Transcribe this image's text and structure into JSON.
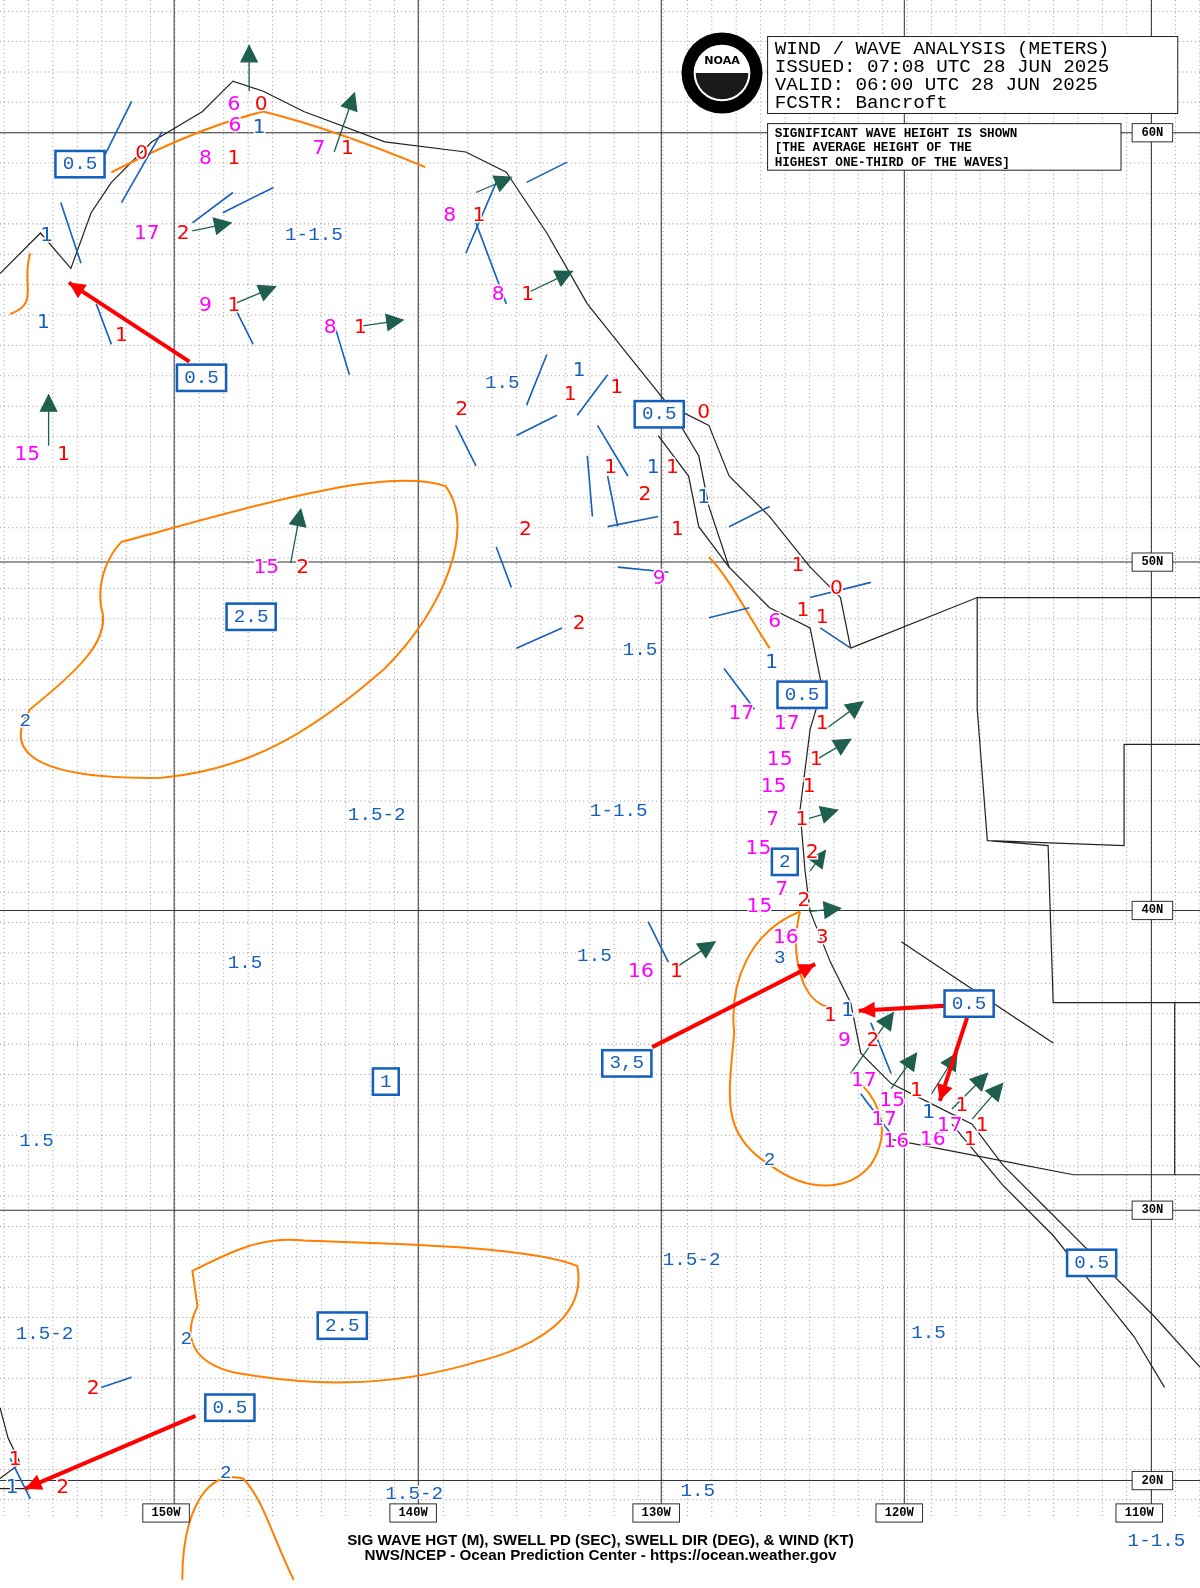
{
  "header": {
    "title": "WIND / WAVE ANALYSIS (METERS)",
    "issued": "ISSUED: 07:08 UTC 28 JUN 2025",
    "valid": "VALID:  06:00 UTC 28 JUN 2025",
    "forecaster": "FCSTR:  Bancroft"
  },
  "logo": {
    "text": "NOAA"
  },
  "note": [
    "SIGNIFICANT WAVE HEIGHT IS SHOWN",
    "[THE AVERAGE HEIGHT OF THE",
    "HIGHEST ONE-THIRD OF THE WAVES]"
  ],
  "latitudes": [
    "60N",
    "50N",
    "40N",
    "30N",
    "20N"
  ],
  "longitudes": [
    "150W",
    "140W",
    "130W",
    "120W",
    "110W"
  ],
  "boxed_labels": [
    "0.5",
    "0.5",
    "0.5",
    "2.5",
    "0.5",
    "2",
    "1",
    "3,5",
    "0.5",
    "0.5",
    "2.5",
    "0.5"
  ],
  "area_labels": [
    "1-1.5",
    "1.5",
    "1.5",
    "1.5-2",
    "1-1.5",
    "1.5",
    "1.5",
    "1.5",
    "1.5-2",
    "1.5-2",
    "1.5",
    "1.5-2",
    "1.5",
    "1-1.5"
  ],
  "contour_labels": [
    "3",
    "2",
    "2",
    "2",
    "2"
  ],
  "observations": [
    {
      "text": "6",
      "kind": "period"
    },
    {
      "text": "6",
      "kind": "period"
    },
    {
      "text": "8",
      "kind": "period"
    },
    {
      "text": "7",
      "kind": "period"
    },
    {
      "text": "17",
      "kind": "period"
    },
    {
      "text": "9",
      "kind": "period"
    },
    {
      "text": "8",
      "kind": "period"
    },
    {
      "text": "8",
      "kind": "period"
    },
    {
      "text": "8",
      "kind": "period"
    },
    {
      "text": "15",
      "kind": "period"
    },
    {
      "text": "15",
      "kind": "period"
    },
    {
      "text": "9",
      "kind": "period"
    },
    {
      "text": "6",
      "kind": "period"
    },
    {
      "text": "17",
      "kind": "period"
    },
    {
      "text": "17",
      "kind": "period"
    },
    {
      "text": "15",
      "kind": "period"
    },
    {
      "text": "15",
      "kind": "period"
    },
    {
      "text": "7",
      "kind": "period"
    },
    {
      "text": "15",
      "kind": "period"
    },
    {
      "text": "7",
      "kind": "period"
    },
    {
      "text": "15",
      "kind": "period"
    },
    {
      "text": "16",
      "kind": "period"
    },
    {
      "text": "16",
      "kind": "period"
    },
    {
      "text": "9",
      "kind": "period"
    },
    {
      "text": "17",
      "kind": "period"
    },
    {
      "text": "15",
      "kind": "period"
    },
    {
      "text": "17",
      "kind": "period"
    },
    {
      "text": "16",
      "kind": "period"
    },
    {
      "text": "16",
      "kind": "period"
    },
    {
      "text": "17",
      "kind": "period"
    },
    {
      "text": "0",
      "kind": "height"
    },
    {
      "text": "0",
      "kind": "height"
    },
    {
      "text": "1",
      "kind": "height"
    },
    {
      "text": "1",
      "kind": "height"
    },
    {
      "text": "2",
      "kind": "height"
    },
    {
      "text": "1",
      "kind": "height"
    },
    {
      "text": "1",
      "kind": "height"
    },
    {
      "text": "1",
      "kind": "height"
    },
    {
      "text": "1",
      "kind": "height"
    },
    {
      "text": "1",
      "kind": "height"
    },
    {
      "text": "1",
      "kind": "height"
    },
    {
      "text": "2",
      "kind": "height"
    },
    {
      "text": "2",
      "kind": "height"
    },
    {
      "text": "1",
      "kind": "height"
    },
    {
      "text": "1",
      "kind": "height"
    },
    {
      "text": "0",
      "kind": "height"
    },
    {
      "text": "1",
      "kind": "height"
    },
    {
      "text": "1",
      "kind": "height"
    },
    {
      "text": "2",
      "kind": "height"
    },
    {
      "text": "1",
      "kind": "height"
    },
    {
      "text": "2",
      "kind": "height"
    },
    {
      "text": "2",
      "kind": "height"
    },
    {
      "text": "1",
      "kind": "height"
    },
    {
      "text": "0",
      "kind": "height"
    },
    {
      "text": "1",
      "kind": "height"
    },
    {
      "text": "1",
      "kind": "height"
    },
    {
      "text": "1",
      "kind": "height"
    },
    {
      "text": "1",
      "kind": "height"
    },
    {
      "text": "1",
      "kind": "height"
    },
    {
      "text": "1",
      "kind": "height"
    },
    {
      "text": "2",
      "kind": "height"
    },
    {
      "text": "2",
      "kind": "height"
    },
    {
      "text": "3",
      "kind": "height"
    },
    {
      "text": "1",
      "kind": "height"
    },
    {
      "text": "1",
      "kind": "height"
    },
    {
      "text": "2",
      "kind": "height"
    },
    {
      "text": "1",
      "kind": "height"
    },
    {
      "text": "1",
      "kind": "height"
    },
    {
      "text": "1",
      "kind": "height"
    },
    {
      "text": "1",
      "kind": "height"
    },
    {
      "text": "2",
      "kind": "height"
    },
    {
      "text": "1",
      "kind": "height"
    },
    {
      "text": "2",
      "kind": "height"
    },
    {
      "text": "1",
      "kind": "low"
    },
    {
      "text": "1",
      "kind": "low"
    },
    {
      "text": "1",
      "kind": "low"
    },
    {
      "text": "1",
      "kind": "low"
    },
    {
      "text": "1",
      "kind": "low"
    },
    {
      "text": "1",
      "kind": "low"
    },
    {
      "text": "1",
      "kind": "low"
    },
    {
      "text": "1",
      "kind": "low"
    },
    {
      "text": "1",
      "kind": "low"
    },
    {
      "text": "1",
      "kind": "low"
    }
  ],
  "footer": [
    "SIG WAVE HGT (M), SWELL PD (SEC), SWELL DIR (DEG), & WIND (KT)",
    "NWS/NCEP - Ocean Prediction Center - https://ocean.weather.gov"
  ]
}
